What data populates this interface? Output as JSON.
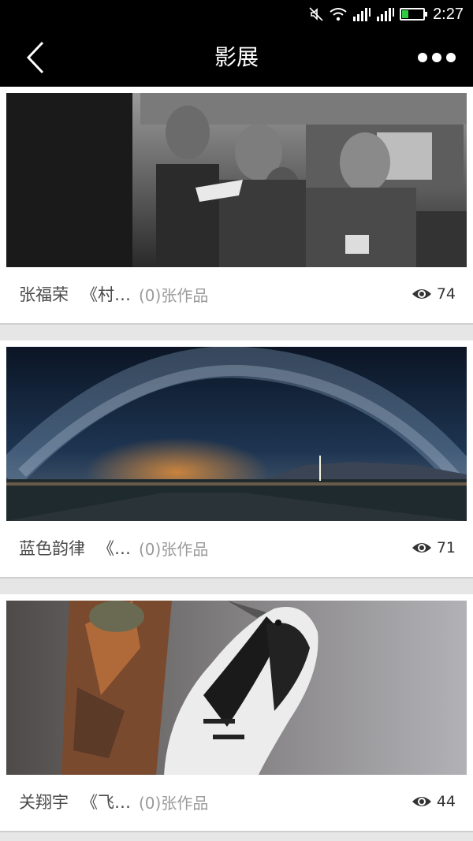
{
  "status_bar": {
    "time": "2:27",
    "icons": [
      "mute-icon",
      "wifi-icon",
      "signal-icon",
      "signal-icon",
      "battery-icon"
    ],
    "battery_level": 0.3,
    "battery_color": "#2ecc40"
  },
  "header": {
    "title": "影展",
    "back_icon": "chevron-left-icon",
    "more_icon": "more-dots-icon"
  },
  "exhibitions": [
    {
      "author": "张福荣",
      "title": "《村…",
      "count": "(0)张作品",
      "views": "74",
      "photo": "crowd-reading-photo"
    },
    {
      "author": "蓝色韵律",
      "title": "《…",
      "count": "(0)张作品",
      "views": "71",
      "photo": "milky-way-photo"
    },
    {
      "author": "关翔宇",
      "title": "《飞…",
      "count": "(0)张作品",
      "views": "44",
      "photo": "woodpecker-photo"
    }
  ]
}
